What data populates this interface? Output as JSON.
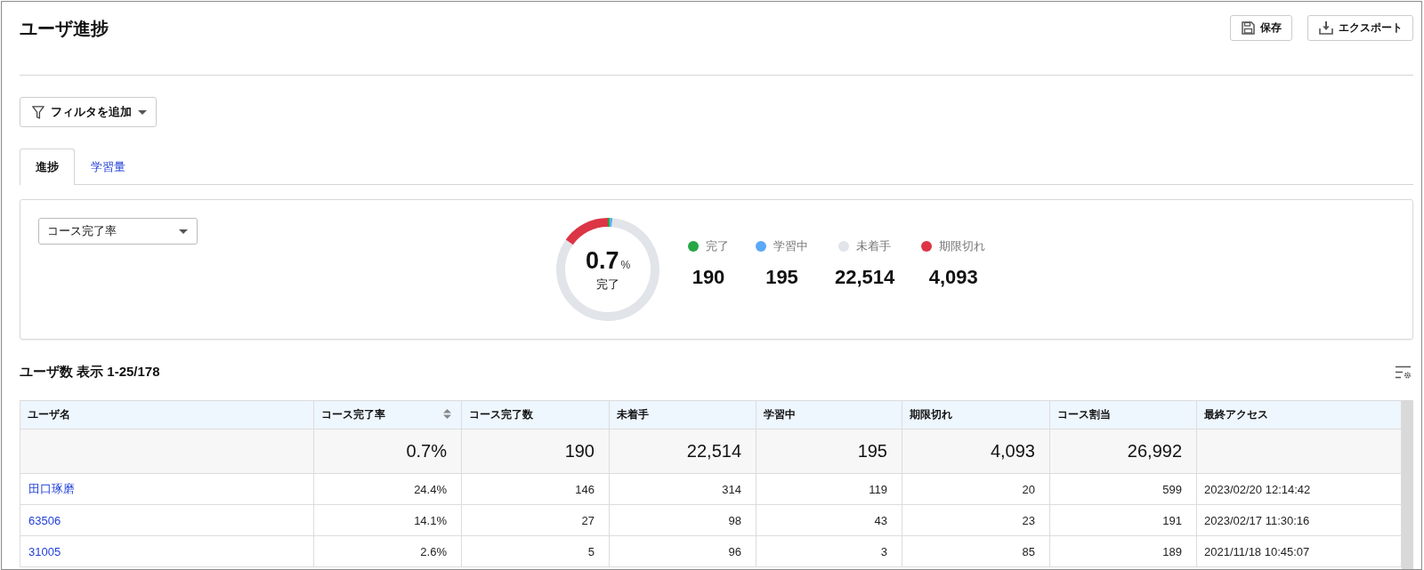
{
  "page": {
    "title": "ユーザ進捗",
    "actions": [
      {
        "kind": "save",
        "label": "保存"
      },
      {
        "kind": "export",
        "label": "エクスポート"
      }
    ]
  },
  "filter_button": {
    "label": "フィルタを追加"
  },
  "tabs": [
    {
      "label": "進捗",
      "selected": true
    },
    {
      "label": "学習量",
      "selected": false
    }
  ],
  "summary": {
    "metric_select": {
      "value": "コース完了率"
    },
    "center_value": "0.7",
    "center_unit": "%",
    "center_label": "完了",
    "chart_data": {
      "type": "donut",
      "categories": [
        "完了",
        "学習中",
        "未着手",
        "期限切れ"
      ],
      "values": [
        190,
        195,
        22514,
        4093
      ],
      "value_labels": [
        "190",
        "195",
        "22,514",
        "4,093"
      ],
      "legend": "right"
    },
    "statuses": [
      {
        "color": "#28a745"
      },
      {
        "color": "#5aa8f7"
      },
      {
        "color": "#e1e4e9"
      },
      {
        "color": "#dc3545"
      }
    ]
  },
  "table": {
    "title": "ユーザ数 表示 1-25/178",
    "columns": [
      {
        "label": "ユーザ名",
        "sortable": false
      },
      {
        "label": "コース完了率",
        "sortable": true
      },
      {
        "label": "コース完了数",
        "sortable": false
      },
      {
        "label": "未着手",
        "sortable": false
      },
      {
        "label": "学習中",
        "sortable": false
      },
      {
        "label": "期限切れ",
        "sortable": false
      },
      {
        "label": "コース割当",
        "sortable": false
      },
      {
        "label": "最終アクセス",
        "sortable": false
      }
    ],
    "totals": [
      "0.7%",
      "190",
      "22,514",
      "195",
      "4,093",
      "26,992"
    ],
    "rows": [
      {
        "user": "田口琢磨",
        "values": [
          "24.4%",
          "146",
          "314",
          "119",
          "20",
          "599",
          "2023/02/20 12:14:42"
        ]
      },
      {
        "user": "63506",
        "values": [
          "14.1%",
          "27",
          "98",
          "43",
          "23",
          "191",
          "2023/02/17 11:30:16"
        ]
      },
      {
        "user": "31005",
        "values": [
          "2.6%",
          "5",
          "96",
          "3",
          "85",
          "189",
          "2021/11/18 10:45:07"
        ]
      }
    ]
  }
}
